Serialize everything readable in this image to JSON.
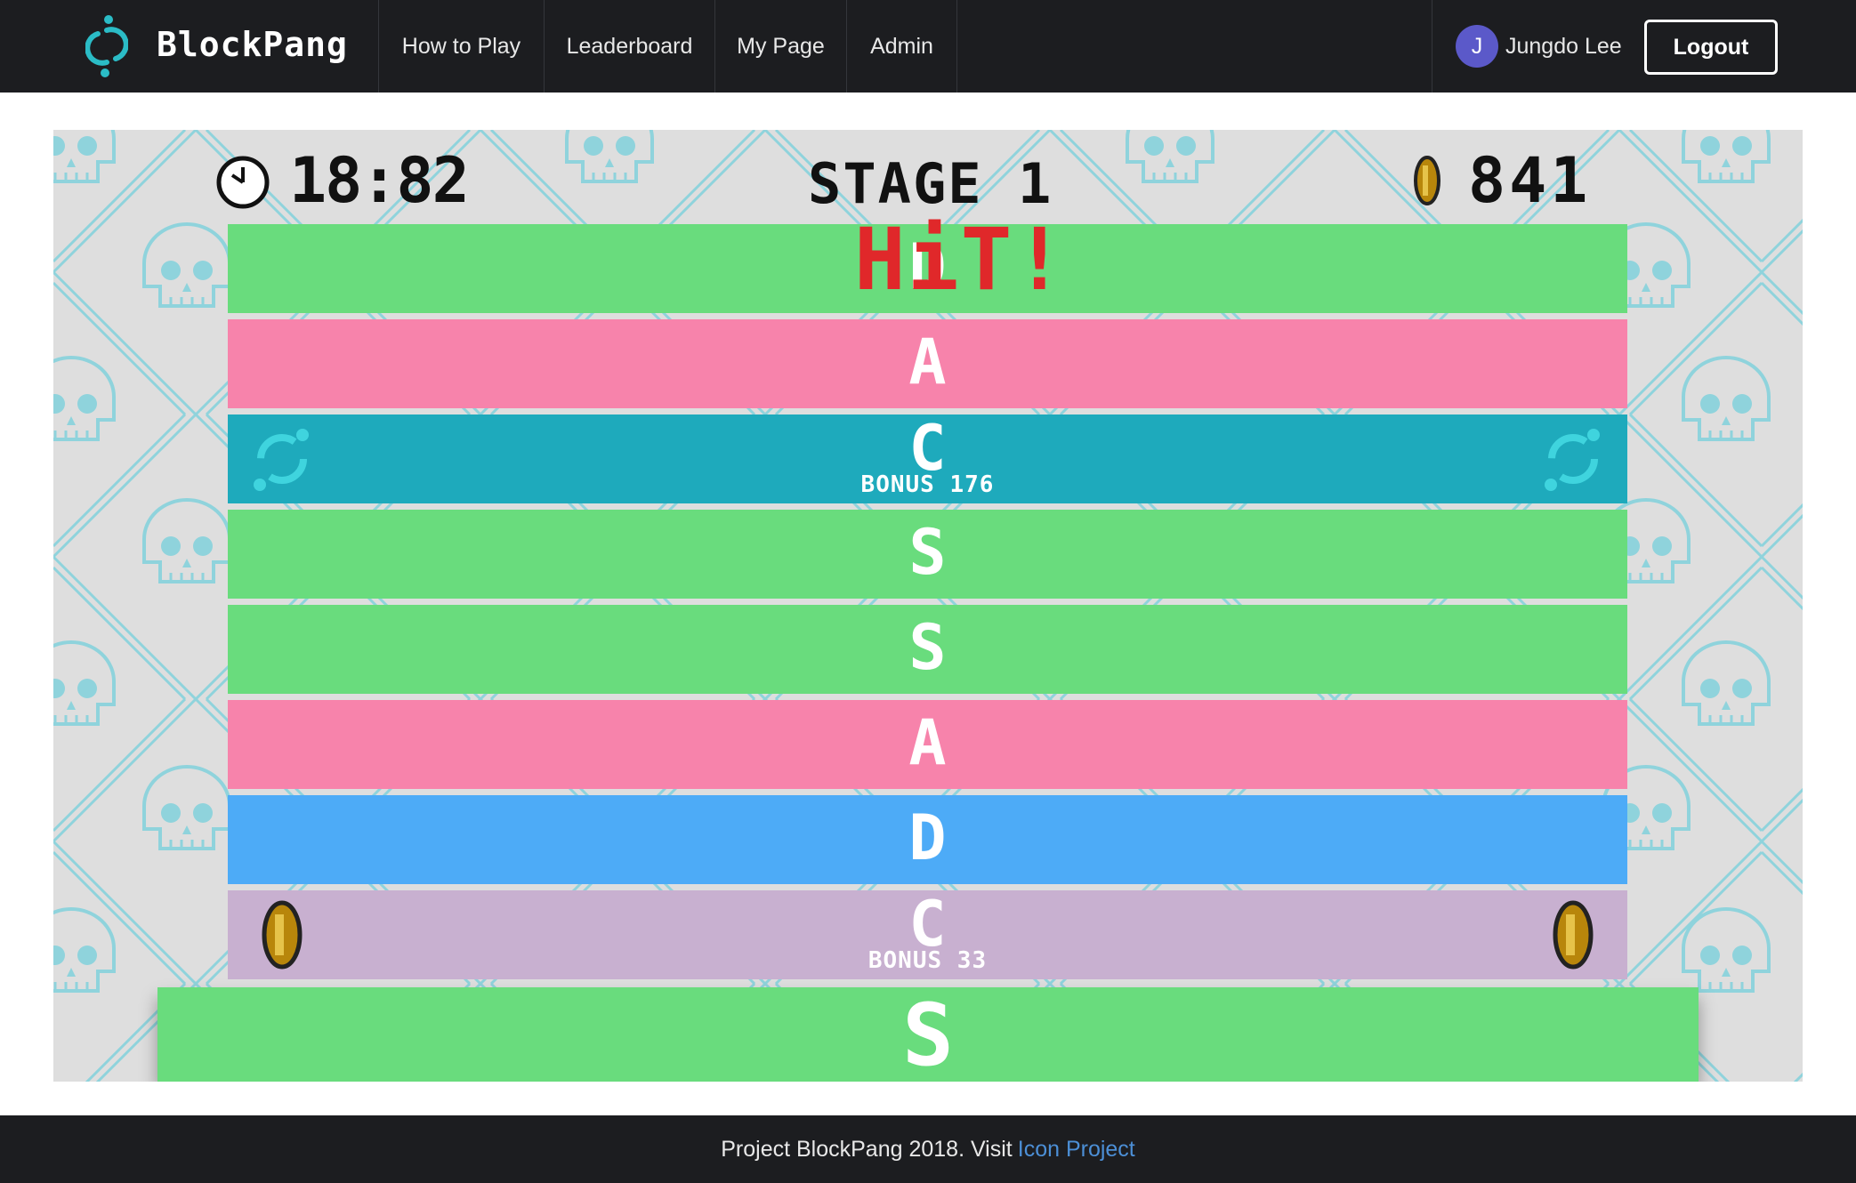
{
  "nav": {
    "brand": "BlockPang",
    "links": [
      "How to Play",
      "Leaderboard",
      "My Page",
      "Admin"
    ],
    "user_initial": "J",
    "user_name": "Jungdo Lee",
    "logout": "Logout"
  },
  "colors": {
    "green": "#69dc7d",
    "pink": "#f783ab",
    "teal": "#1eaabc",
    "blue": "#4dabf7",
    "lilac": "#c8b0d0",
    "hit": "#e0282a",
    "nav_bg": "#1c1d20",
    "brand_accent": "#2bbcc6"
  },
  "game": {
    "timer": "18:82",
    "stage": "STAGE 1",
    "coins": "841",
    "hit_text": "HiT!",
    "rows": [
      {
        "letter": "D",
        "color": "green",
        "bonus": "",
        "icon": ""
      },
      {
        "letter": "A",
        "color": "pink",
        "bonus": "",
        "icon": ""
      },
      {
        "letter": "C",
        "color": "teal",
        "bonus": "BONUS 176",
        "icon": "icon-logo"
      },
      {
        "letter": "S",
        "color": "green",
        "bonus": "",
        "icon": ""
      },
      {
        "letter": "S",
        "color": "green",
        "bonus": "",
        "icon": ""
      },
      {
        "letter": "A",
        "color": "pink",
        "bonus": "",
        "icon": ""
      },
      {
        "letter": "D",
        "color": "blue",
        "bonus": "",
        "icon": ""
      },
      {
        "letter": "C",
        "color": "lilac",
        "bonus": "BONUS 33",
        "icon": "coin"
      }
    ],
    "active_row": {
      "letter": "S",
      "color": "green"
    }
  },
  "footer": {
    "text": "Project BlockPang 2018. Visit",
    "link": "Icon Project"
  }
}
